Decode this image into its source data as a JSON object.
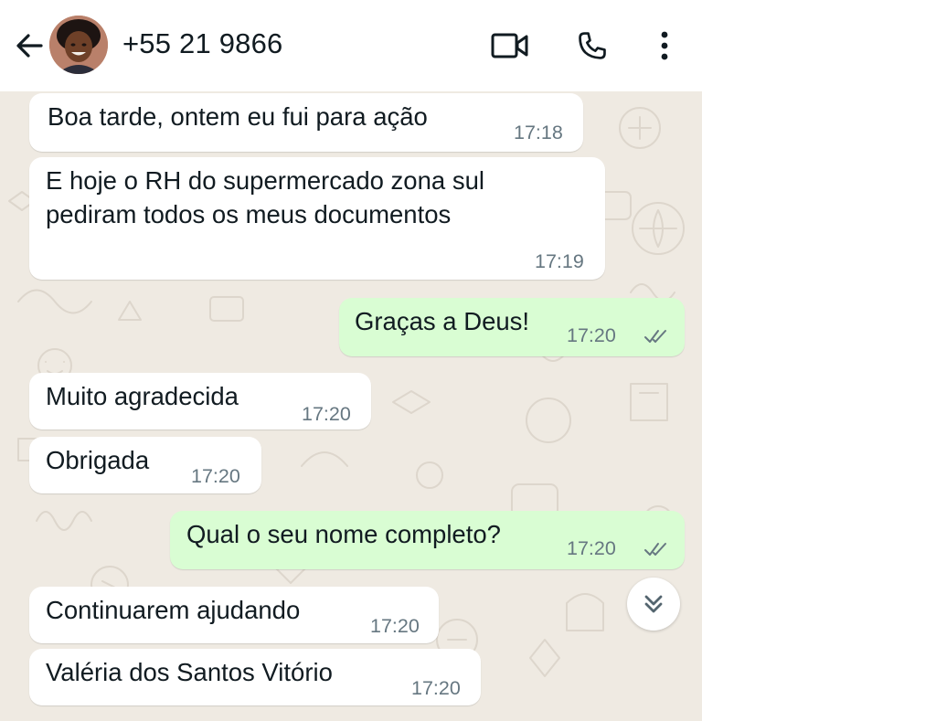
{
  "header": {
    "contact_name": "+55 21 9866",
    "back_icon": "arrow-left-icon",
    "video_icon": "video-camera-icon",
    "call_icon": "phone-icon",
    "menu_icon": "more-vertical-icon"
  },
  "messages": [
    {
      "direction": "in",
      "lines": [
        "Boa tarde, ontem eu fui para ação"
      ],
      "time": "17:18"
    },
    {
      "direction": "in",
      "lines": [
        "E hoje  o RH do  supermercado zona sul",
        "pediram todos os meus  documentos"
      ],
      "time": "17:19"
    },
    {
      "direction": "out",
      "lines": [
        "Graças a Deus!"
      ],
      "time": "17:20",
      "status": "read"
    },
    {
      "direction": "in",
      "lines": [
        "Muito agradecida"
      ],
      "time": "17:20"
    },
    {
      "direction": "in",
      "lines": [
        "Obrigada"
      ],
      "time": "17:20"
    },
    {
      "direction": "out",
      "lines": [
        "Qual o seu nome completo?"
      ],
      "time": "17:20",
      "status": "read"
    },
    {
      "direction": "in",
      "lines": [
        "Continuarem ajudando"
      ],
      "time": "17:20"
    },
    {
      "direction": "in",
      "lines": [
        "Valéria dos Santos Vitório"
      ],
      "time": "17:20"
    }
  ],
  "scroll_button_icon": "double-chevron-down-icon",
  "colors": {
    "incoming_bubble": "#ffffff",
    "outgoing_bubble": "#d9fdd3",
    "chat_background": "#efeae2",
    "timestamp": "#667781",
    "read_ticks": "#667781"
  }
}
